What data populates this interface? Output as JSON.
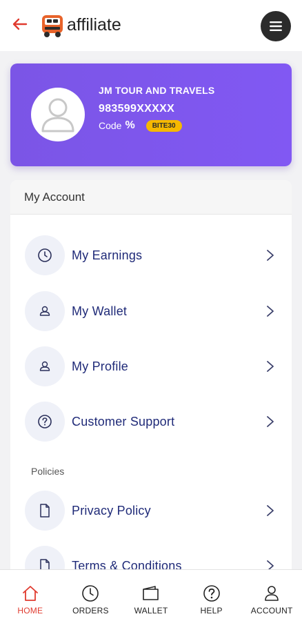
{
  "header": {
    "brand": "affiliate",
    "back_icon": "arrow-left-icon",
    "menu_icon": "hamburger-icon",
    "accent_color": "#e03a2e"
  },
  "profile": {
    "name": "JM TOUR AND TRAVELS",
    "phone": "983599XXXXX",
    "code_label": "Code",
    "code_symbol": "%",
    "coupon_code": "BITE30",
    "card_color": "#7f57ef",
    "coupon_color": "#f5b800"
  },
  "account": {
    "title": "My Account",
    "items": [
      {
        "label": "My Earnings",
        "icon": "clock-icon"
      },
      {
        "label": "My Wallet",
        "icon": "user-icon"
      },
      {
        "label": "My Profile",
        "icon": "user-icon"
      },
      {
        "label": "Customer Support",
        "icon": "question-icon"
      }
    ],
    "policies_label": "Policies",
    "policy_items": [
      {
        "label": "Privacy Policy",
        "icon": "document-icon"
      },
      {
        "label": "Terms & Conditions",
        "icon": "document-icon"
      }
    ]
  },
  "bottom_nav": {
    "items": [
      {
        "label": "HOME",
        "icon": "home-icon",
        "active": true
      },
      {
        "label": "ORDERS",
        "icon": "clock-icon",
        "active": false
      },
      {
        "label": "WALLET",
        "icon": "wallet-icon",
        "active": false
      },
      {
        "label": "HELP",
        "icon": "question-icon",
        "active": false
      },
      {
        "label": "ACCOUNT",
        "icon": "user-icon",
        "active": false
      }
    ]
  }
}
